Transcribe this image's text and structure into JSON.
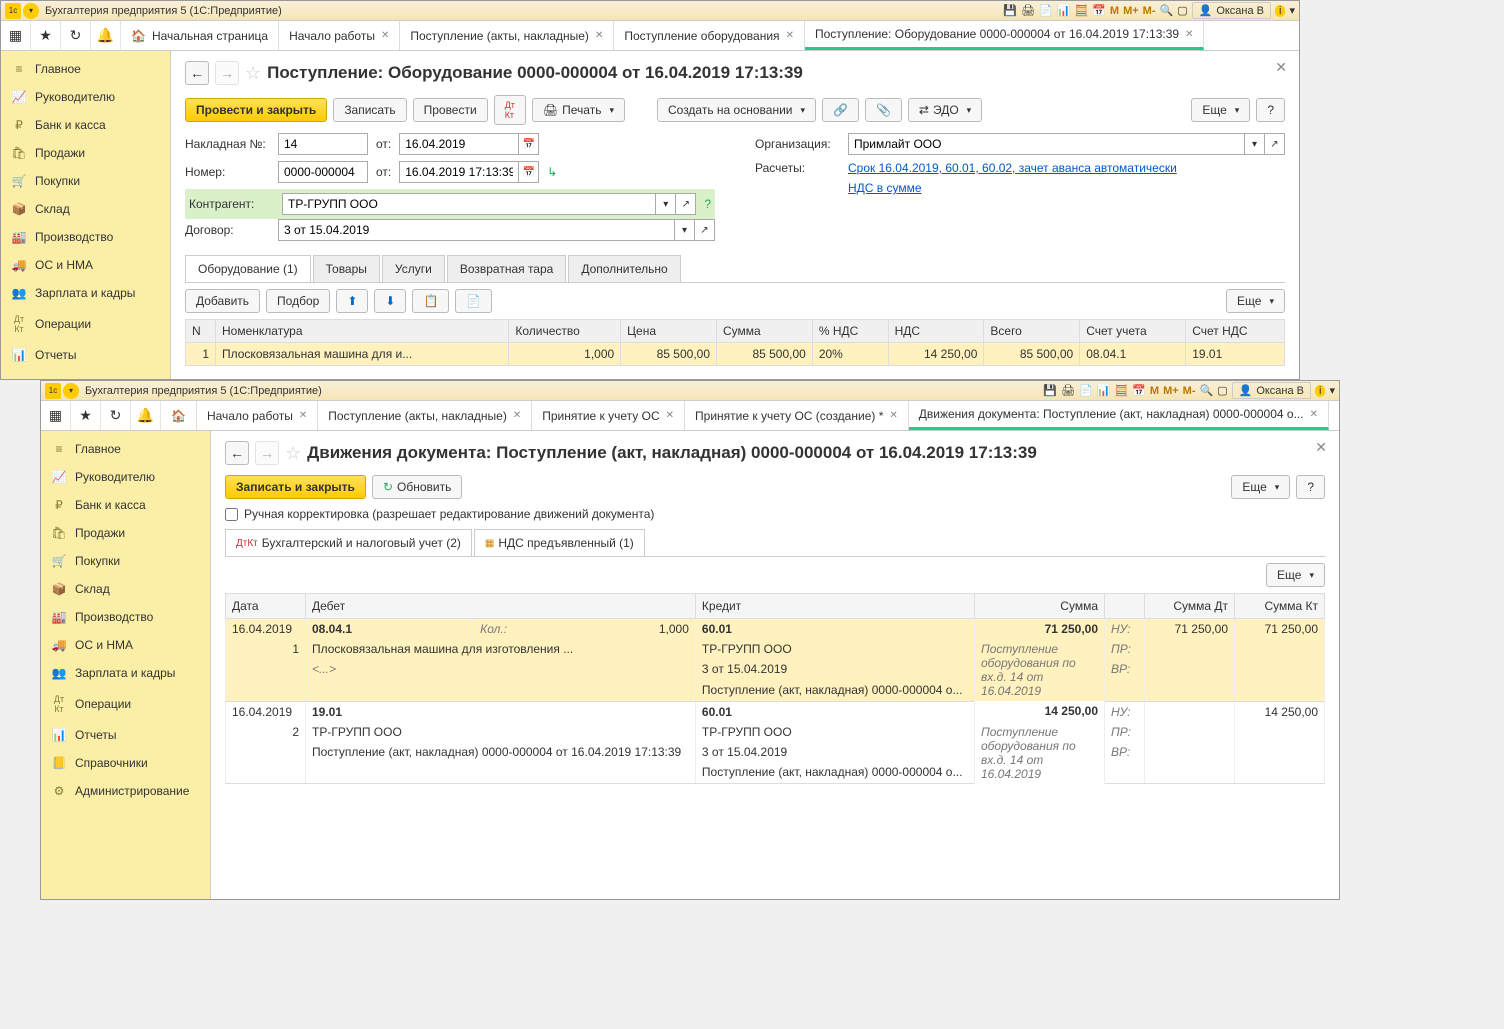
{
  "win1": {
    "app_title": "Бухгалтерия предприятия 5  (1С:Предприятие)",
    "user": "Оксана В",
    "tabs": [
      {
        "label": "Начальная страница",
        "home": true
      },
      {
        "label": "Начало работы",
        "close": true
      },
      {
        "label": "Поступление (акты, накладные)",
        "close": true
      },
      {
        "label": "Поступление оборудования",
        "close": true
      },
      {
        "label": "Поступление: Оборудование 0000-000004 от 16.04.2019 17:13:39",
        "close": true,
        "active": true
      }
    ],
    "sidebar": [
      "Главное",
      "Руководителю",
      "Банк и касса",
      "Продажи",
      "Покупки",
      "Склад",
      "Производство",
      "ОС и НМА",
      "Зарплата и кадры",
      "Операции",
      "Отчеты"
    ],
    "page_title": "Поступление: Оборудование 0000-000004 от 16.04.2019 17:13:39",
    "actions": {
      "post_close": "Провести и закрыть",
      "write": "Записать",
      "post": "Провести",
      "print": "Печать",
      "create_based": "Создать на основании",
      "edo": "ЭДО",
      "more": "Еще"
    },
    "form": {
      "invoice_no_label": "Накладная  №:",
      "invoice_no": "14",
      "from1_label": "от:",
      "invoice_date": "16.04.2019",
      "number_label": "Номер:",
      "number": "0000-000004",
      "from2_label": "от:",
      "datetime": "16.04.2019 17:13:39",
      "counterparty_label": "Контрагент:",
      "counterparty": "ТР-ГРУПП ООО",
      "contract_label": "Договор:",
      "contract": "3 от 15.04.2019",
      "org_label": "Организация:",
      "org": "Примлайт ООО",
      "calc_label": "Расчеты:",
      "calc_link": "Срок 16.04.2019, 60.01, 60.02, зачет аванса автоматически",
      "vat_link": "НДС в сумме"
    },
    "sub_tabs": [
      "Оборудование (1)",
      "Товары",
      "Услуги",
      "Возвратная тара",
      "Дополнительно"
    ],
    "grid_btns": {
      "add": "Добавить",
      "pick": "Подбор"
    },
    "grid": {
      "headers": [
        "N",
        "Номенклатура",
        "Количество",
        "Цена",
        "Сумма",
        "% НДС",
        "НДС",
        "Всего",
        "Счет учета",
        "Счет НДС"
      ],
      "row": [
        "1",
        "Плосковязальная машина для и...",
        "1,000",
        "85 500,00",
        "85 500,00",
        "20%",
        "14 250,00",
        "85 500,00",
        "08.04.1",
        "19.01"
      ]
    }
  },
  "win2": {
    "app_title": "Бухгалтерия предприятия 5  (1С:Предприятие)",
    "user": "Оксана В",
    "tabs": [
      {
        "label": "",
        "home": true
      },
      {
        "label": "Начало работы",
        "close": true
      },
      {
        "label": "Поступление (акты, накладные)",
        "close": true
      },
      {
        "label": "Принятие к учету ОС",
        "close": true
      },
      {
        "label": "Принятие к учету ОС (создание) *",
        "close": true
      },
      {
        "label": "Движения документа: Поступление (акт, накладная) 0000-000004 о...",
        "close": true,
        "active": true
      }
    ],
    "sidebar": [
      "Главное",
      "Руководителю",
      "Банк и касса",
      "Продажи",
      "Покупки",
      "Склад",
      "Производство",
      "ОС и НМА",
      "Зарплата и кадры",
      "Операции",
      "Отчеты",
      "Справочники",
      "Администрирование"
    ],
    "page_title": "Движения документа: Поступление (акт, накладная) 0000-000004 от 16.04.2019 17:13:39",
    "actions": {
      "write_close": "Записать и закрыть",
      "refresh": "Обновить",
      "more": "Еще"
    },
    "manual_edit": "Ручная корректировка (разрешает редактирование движений документа)",
    "doc_tabs": [
      "Бухгалтерский и налоговый учет (2)",
      "НДС предъявленный (1)"
    ],
    "ledger_headers": [
      "Дата",
      "Дебет",
      "Кредит",
      "Сумма",
      "Сумма Дт",
      "Сумма Кт"
    ],
    "ledger": {
      "r1": {
        "date": "16.04.2019",
        "n": "1",
        "debit_acc": "08.04.1",
        "qty_label": "Кол.:",
        "qty": "1,000",
        "debit_l1": "Плосковязальная машина для изготовления ...",
        "debit_l2": "<...>",
        "credit_acc": "60.01",
        "credit_l1": "ТР-ГРУПП ООО",
        "credit_l2": "3 от 15.04.2019",
        "credit_l3": "Поступление (акт, накладная) 0000-000004 о...",
        "sum": "71 250,00",
        "desc": "Поступление оборудования по вх.д. 14 от 16.04.2019",
        "nu": "НУ:",
        "pr": "ПР:",
        "vr": "ВР:",
        "sum_dt": "71 250,00",
        "sum_kt": "71 250,00"
      },
      "r2": {
        "date": "16.04.2019",
        "n": "2",
        "debit_acc": "19.01",
        "debit_l1": "ТР-ГРУПП ООО",
        "debit_l2": "Поступление (акт, накладная) 0000-000004 от 16.04.2019 17:13:39",
        "credit_acc": "60.01",
        "credit_l1": "ТР-ГРУПП ООО",
        "credit_l2": "3 от 15.04.2019",
        "credit_l3": "Поступление (акт, накладная) 0000-000004 о...",
        "sum": "14 250,00",
        "desc": "Поступление оборудования по вх.д. 14 от 16.04.2019",
        "nu": "НУ:",
        "pr": "ПР:",
        "vr": "ВР:",
        "sum_dt": "",
        "sum_kt": "14 250,00"
      }
    }
  }
}
